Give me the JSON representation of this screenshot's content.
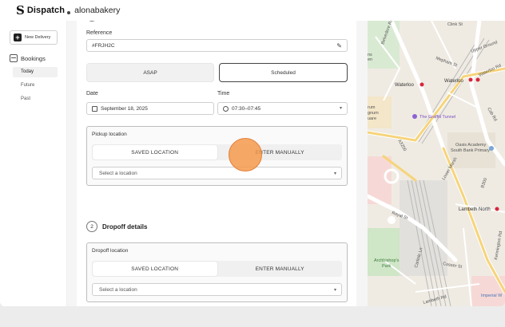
{
  "header": {
    "brand_mark": "S",
    "brand_name": "Dispatch",
    "org_name": "alonabakery"
  },
  "sidebar": {
    "new_delivery_label": "New Delivery",
    "bookings_label": "Bookings",
    "items": [
      {
        "label": "Today",
        "active": true
      },
      {
        "label": "Future",
        "active": false
      },
      {
        "label": "Past",
        "active": false
      }
    ]
  },
  "form": {
    "reference_label": "Reference",
    "reference_value": "#FRJH2C",
    "timing_options": [
      "ASAP",
      "Scheduled"
    ],
    "timing_selected": "Scheduled",
    "date_label": "Date",
    "date_value": "September 18, 2025",
    "time_label": "Time",
    "time_value": "07:30–07:45",
    "pickup": {
      "title": "Pickup location",
      "tabs": [
        "SAVED LOCATION",
        "ENTER MANUALLY"
      ],
      "selected_tab": "SAVED LOCATION",
      "placeholder": "Select a location"
    },
    "dropoff_step_number": "2",
    "dropoff_step_title": "Dropoff details",
    "dropoff": {
      "title": "Dropoff location",
      "tabs": [
        "SAVED LOCATION",
        "ENTER MANUALLY"
      ],
      "selected_tab": "SAVED LOCATION",
      "placeholder": "Select a location"
    }
  },
  "map": {
    "labels": {
      "clink": "Clink St",
      "belvedere": "Belvedere Rd",
      "upper_ground": "Upper Ground",
      "mepham": "Mepham St",
      "waterloo_rd": "Waterloo Rd",
      "waterloo_a": "Waterloo",
      "waterloo_b": "Waterloo",
      "graffiti": "The Graffiti Tunnel",
      "oasis_1": "Oasis Academy",
      "oasis_2": "South Bank Primary",
      "lower_marsh": "Lower Marsh",
      "a3200": "A3200",
      "cab_rd": "Cab Rd",
      "b300": "B300",
      "lambeth_north": "Lambeth North",
      "royal": "Royal St",
      "carlisle": "Carlisle Ln",
      "archbishops_1": "Archbishop's",
      "archbishops_2": "Park",
      "cosser": "Cosser St",
      "kennington": "Kennington Rd",
      "lambeth_rd": "Lambeth Rd",
      "imperial": "Imperial W",
      "edge_1": "rum",
      "edge_2": "gnum",
      "edge_3": "uare",
      "edge_4": "ns",
      "edge_5": "en"
    }
  }
}
